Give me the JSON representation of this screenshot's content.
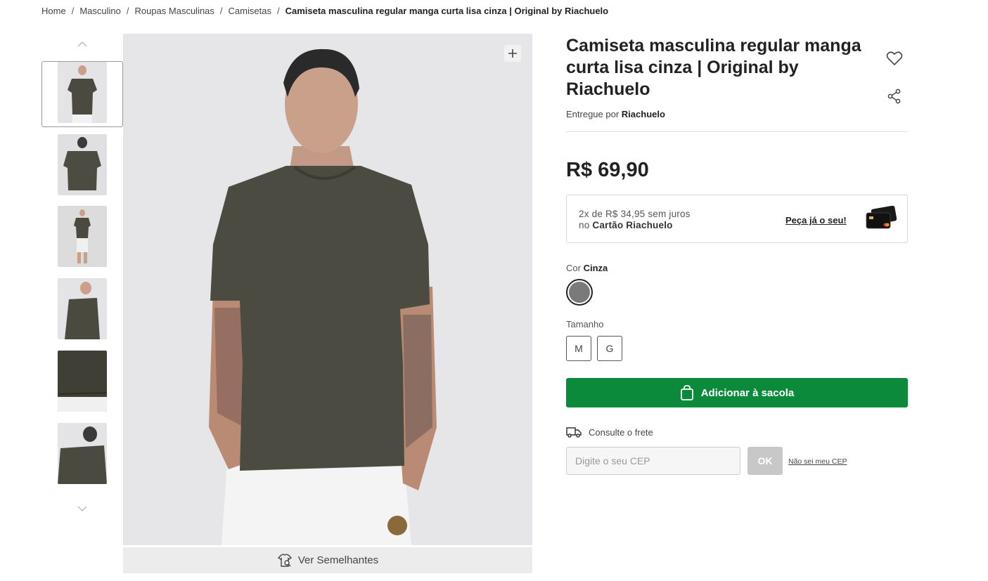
{
  "breadcrumb": {
    "items": [
      "Home",
      "Masculino",
      "Roupas Masculinas",
      "Camisetas"
    ],
    "separator": "/",
    "current": "Camiseta masculina regular manga curta lisa cinza | Original by Riachuelo"
  },
  "gallery": {
    "thumbnail_count": 6,
    "selected_thumbnail": 1,
    "similar_label": "Ver Semelhantes"
  },
  "product": {
    "title": "Camiseta masculina regular manga curta lisa cinza | Original by Riachuelo",
    "seller_prefix": "Entregue por",
    "seller": "Riachuelo",
    "price": "R$ 69,90",
    "installments_line1": "2x de R$ 34,95 sem juros",
    "installments_line2_prefix": "no",
    "installments_line2_card": "Cartão Riachuelo",
    "card_cta": "Peça já o seu!"
  },
  "options": {
    "color_label": "Cor",
    "color_value": "Cinza",
    "color_hex": "#7a7a7a",
    "size_label": "Tamanho",
    "sizes": [
      "M",
      "G"
    ]
  },
  "cart": {
    "add_label": "Adicionar à sacola",
    "button_color": "#0a8a3a"
  },
  "shipping": {
    "label": "Consulte o frete",
    "placeholder": "Digite o seu CEP",
    "ok_label": "OK",
    "unknown_cep_label": "Não sei meu CEP"
  }
}
